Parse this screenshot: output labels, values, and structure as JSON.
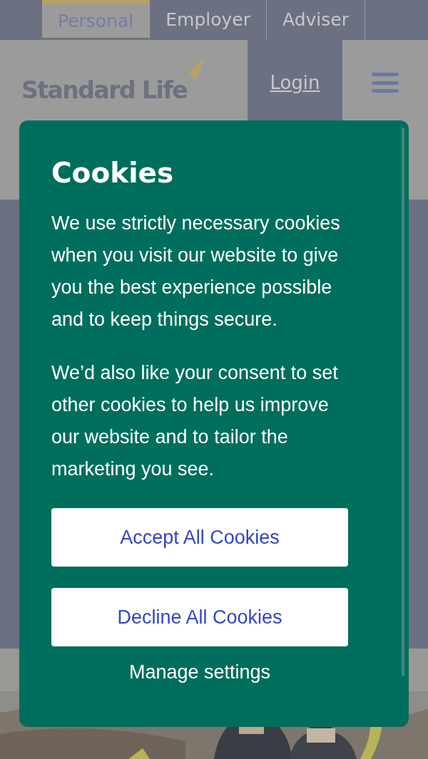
{
  "tabs": [
    {
      "label": "Personal",
      "selected": true
    },
    {
      "label": "Employer",
      "selected": false
    },
    {
      "label": "Adviser",
      "selected": false
    }
  ],
  "header": {
    "logo": "Standard Life",
    "login": "Login"
  },
  "cookie_dialog": {
    "title": "Cookies",
    "paragraphs": [
      "We use strictly necessary cookies when you visit our website to give you the best experience possible and to keep things secure.",
      "We’d also like your consent to set other cookies to help us improve our website and to tailor the marketing you see."
    ],
    "buttons": [
      "Accept All Cookies",
      "Decline All Cookies"
    ],
    "link": "Manage settings"
  }
}
